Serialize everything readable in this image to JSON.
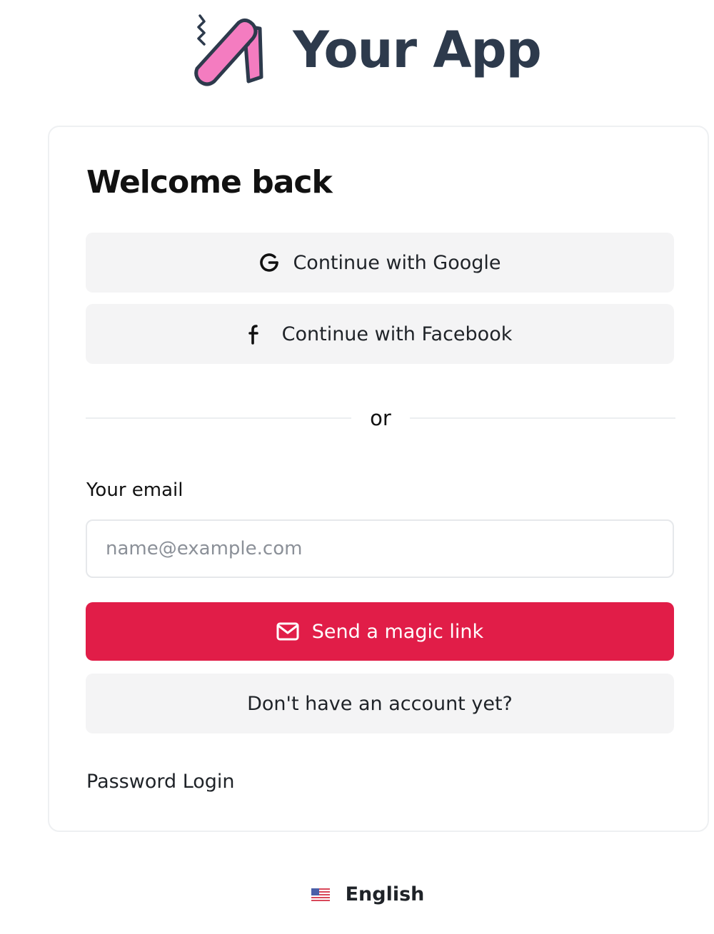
{
  "brand": {
    "logo_icon": "pink-slanted-logo-icon",
    "name": "Your App",
    "color": "#2d3a4c",
    "logo_color": "#f47cc0"
  },
  "card": {
    "title": "Welcome back",
    "google": {
      "label": "Continue with Google",
      "icon": "google-icon"
    },
    "facebook": {
      "label": "Continue with Facebook",
      "icon": "facebook-icon"
    },
    "divider_text": "or",
    "email": {
      "label": "Your email",
      "placeholder": "name@example.com",
      "value": ""
    },
    "magic_link": {
      "label": "Send a magic link",
      "icon": "mail-icon",
      "color": "#e11d48"
    },
    "signup_label": "Don't have an account yet?",
    "password_login_label": "Password Login"
  },
  "language": {
    "flag_icon": "us-flag-icon",
    "label": "English"
  }
}
